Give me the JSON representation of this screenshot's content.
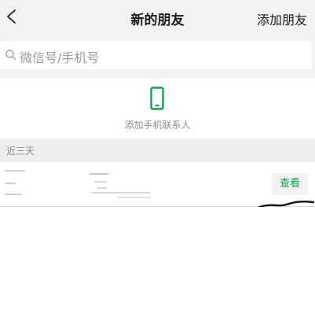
{
  "header": {
    "title": "新的朋友",
    "add_friend_label": "添加朋友"
  },
  "search": {
    "placeholder": "微信号/手机号"
  },
  "contacts": {
    "label": "添加手机联系人"
  },
  "section": {
    "label": "近三天"
  },
  "request": {
    "view_label": "查看"
  },
  "colors": {
    "accent": "#07a44b",
    "background": "#f2f2f2"
  }
}
